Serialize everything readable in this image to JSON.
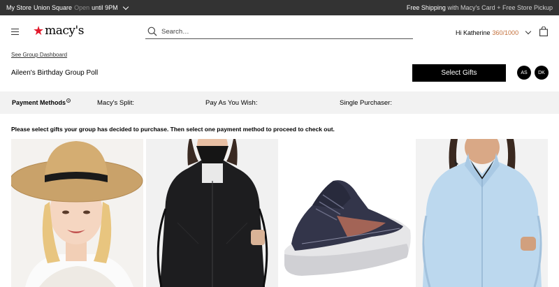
{
  "topbar": {
    "store_prefix": "My Store",
    "store_name": "Union Square",
    "open_label": "Open",
    "hours": "until 9PM",
    "promo_main": "Free Shipping",
    "promo_mid": "with Macy's Card",
    "promo_end": "+ Free Store Pickup"
  },
  "header": {
    "logo_text": "macy's",
    "search_placeholder": "Search…",
    "greeting": "Hi Katherine",
    "points": "360/1000"
  },
  "group": {
    "dashboard_link": "See Group Dashboard",
    "title": "Aileen's Birthday Group Poll",
    "select_button": "Select Gifts",
    "avatars": [
      "AS",
      "DK"
    ]
  },
  "payment": {
    "methods_label": "Payment Methods",
    "split_label": "Macy's Split:",
    "pay_as_you_wish_label": "Pay As You Wish:",
    "single_label": "Single Purchaser:"
  },
  "instructions": "Please select gifts your group has decided to purchase. Then select one payment method to proceed to check out.",
  "products": [
    {
      "icon": "straw-sun-hat-image"
    },
    {
      "icon": "black-rain-jacket-image"
    },
    {
      "icon": "navy-running-shoe-image"
    },
    {
      "icon": "light-blue-fleece-jacket-image"
    }
  ],
  "colors": {
    "topbar_bg": "#333333",
    "brand_red": "#e21a2c",
    "points_accent": "#c36f3a",
    "paybar_bg": "#f2f2f2"
  }
}
